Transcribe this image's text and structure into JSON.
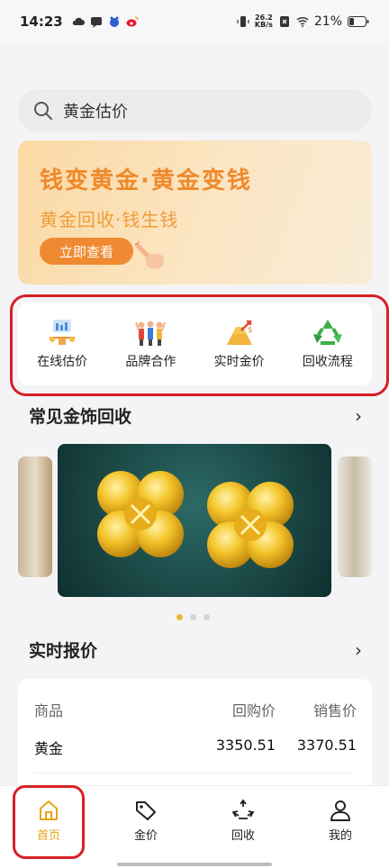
{
  "status_bar": {
    "time": "14:23",
    "net_speed_value": "26.2",
    "net_speed_unit": "KB/s",
    "battery": "21%"
  },
  "search": {
    "placeholder": "黄金估价"
  },
  "banner": {
    "title": "钱变黄金·黄金变钱",
    "subtitle": "黄金回收·钱生钱",
    "button": "立即查看"
  },
  "quick_menu": [
    {
      "label": "在线估价",
      "icon": "valuation-scale-icon"
    },
    {
      "label": "品牌合作",
      "icon": "brand-team-icon"
    },
    {
      "label": "实时金价",
      "icon": "gold-price-icon"
    },
    {
      "label": "回收流程",
      "icon": "recycle-icon"
    }
  ],
  "jewelry_section": {
    "title": "常见金饰回收"
  },
  "carousel": {
    "slides": 3,
    "active_index": 0
  },
  "price_section": {
    "title": "实时报价",
    "columns": [
      "商品",
      "回购价",
      "销售价"
    ],
    "rows": [
      {
        "name": "黄金",
        "buy": "3350.51",
        "sell": "3370.51"
      }
    ]
  },
  "bottom_nav": [
    {
      "label": "首页",
      "icon": "home-icon",
      "active": true
    },
    {
      "label": "金价",
      "icon": "tag-icon",
      "active": false
    },
    {
      "label": "回收",
      "icon": "recycle-icon",
      "active": false
    },
    {
      "label": "我的",
      "icon": "user-icon",
      "active": false
    }
  ],
  "colors": {
    "accent": "#e8a31b",
    "banner_orange": "#f08a32",
    "highlight_red": "#d81f26"
  }
}
